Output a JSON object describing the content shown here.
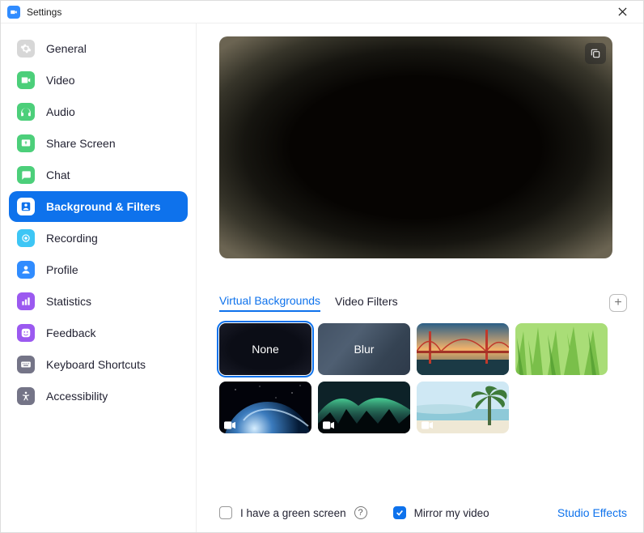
{
  "window": {
    "title": "Settings"
  },
  "sidebar": {
    "items": [
      {
        "id": "general",
        "label": "General",
        "icon": "gear",
        "color": "#d7d7d7"
      },
      {
        "id": "video",
        "label": "Video",
        "icon": "video",
        "color": "#4ccf7a"
      },
      {
        "id": "audio",
        "label": "Audio",
        "icon": "headphones",
        "color": "#4ccf7a"
      },
      {
        "id": "share-screen",
        "label": "Share Screen",
        "icon": "share",
        "color": "#4ccf7a"
      },
      {
        "id": "chat",
        "label": "Chat",
        "icon": "chat",
        "color": "#4ccf7a"
      },
      {
        "id": "background-filters",
        "label": "Background & Filters",
        "icon": "portrait",
        "color": "#308CFF",
        "active": true
      },
      {
        "id": "recording",
        "label": "Recording",
        "icon": "record",
        "color": "#3dc6f5"
      },
      {
        "id": "profile",
        "label": "Profile",
        "icon": "person",
        "color": "#308CFF"
      },
      {
        "id": "statistics",
        "label": "Statistics",
        "icon": "stats",
        "color": "#9b59f0"
      },
      {
        "id": "feedback",
        "label": "Feedback",
        "icon": "smile",
        "color": "#9b59f0"
      },
      {
        "id": "keyboard-shortcuts",
        "label": "Keyboard Shortcuts",
        "icon": "keyboard",
        "color": "#747487"
      },
      {
        "id": "accessibility",
        "label": "Accessibility",
        "icon": "accessibility",
        "color": "#747487"
      }
    ]
  },
  "main": {
    "tabs": [
      {
        "id": "virtual-backgrounds",
        "label": "Virtual Backgrounds",
        "active": true
      },
      {
        "id": "video-filters",
        "label": "Video Filters",
        "active": false
      }
    ],
    "backgrounds": [
      {
        "id": "none",
        "label": "None",
        "selected": true
      },
      {
        "id": "blur",
        "label": "Blur"
      },
      {
        "id": "golden-gate",
        "label": ""
      },
      {
        "id": "grass",
        "label": ""
      },
      {
        "id": "earth",
        "label": "",
        "is_video": true
      },
      {
        "id": "aurora",
        "label": "",
        "is_video": true
      },
      {
        "id": "beach",
        "label": "",
        "is_video": true
      }
    ]
  },
  "footer": {
    "greenscreen": {
      "label": "I have a green screen",
      "checked": false
    },
    "mirror": {
      "label": "Mirror my video",
      "checked": true
    },
    "studio_link": "Studio Effects"
  },
  "colors": {
    "accent": "#0E72EC"
  }
}
